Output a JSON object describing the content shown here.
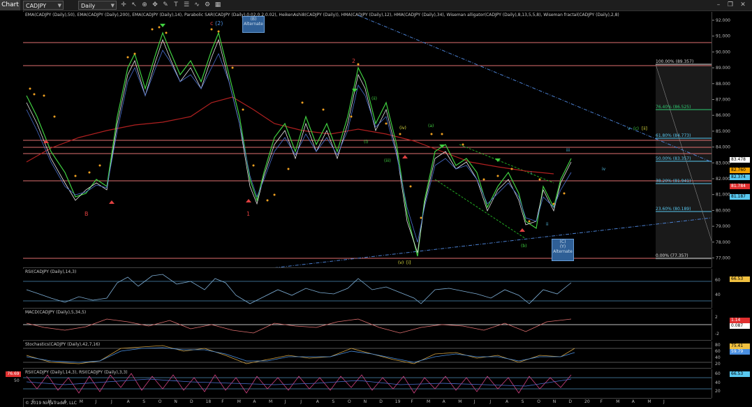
{
  "toolbar": {
    "chart_tab": "Chart",
    "instrument": "CADJPY",
    "period": "Daily",
    "icons": [
      "crosshair-icon",
      "pointer-icon",
      "zoom-icon",
      "pan-icon",
      "draw-icon",
      "text-icon",
      "properties-icon",
      "indicators-icon",
      "strategies-icon",
      "windows-icon",
      "minimize-icon",
      "restore-icon",
      "close-icon"
    ]
  },
  "price_panel": {
    "indicator_label": "EMA(CADJPY (Daily),50), EMA(CADJPY (Daily),200), EMA(CADJPY (Daily),14), Parabolic SAR(CADJPY (Daily),0.02,0.2,0.02), HeikenAshi8(CADJPY (Daily)), HMA(CADJPY (Daily),12), HMA(CADJPY (Daily),34), Wiseman alligator(CADJPY (Daily),8,13,5,5,8), Wiseman fractal(CADJPY (Daily),2,8)",
    "price_ticks": [
      "92.000",
      "91.000",
      "90.000",
      "89.000",
      "88.000",
      "87.000",
      "86.000",
      "85.000",
      "84.000",
      "83.000",
      "82.000",
      "81.000",
      "80.000",
      "79.000",
      "78.000",
      "77.000"
    ],
    "badges": [
      {
        "text": "83.478",
        "bg": "#ffffff"
      },
      {
        "text": "82.760",
        "bg": "#f0a000"
      },
      {
        "text": "82.374",
        "bg": "#58c8f0"
      },
      {
        "text": "81.784",
        "bg": "#e03030"
      },
      {
        "text": "81.187",
        "bg": "#58c8f0"
      }
    ],
    "fib_levels": [
      {
        "label": "100.00% (89.357)",
        "color": "#dddddd"
      },
      {
        "label": "76.40% (86.525)",
        "color": "#2ecc71"
      },
      {
        "label": "61.80% (84.773)",
        "color": "#58c8f0"
      },
      {
        "label": "50.00% (83.357)",
        "color": "#58c8f0"
      },
      {
        "label": "38.20% (81.941)",
        "color": "#58c8f0"
      },
      {
        "label": "23.60% (80.189)",
        "color": "#58c8f0"
      },
      {
        "label": "0.00% (77.357)",
        "color": "#dddddd"
      }
    ],
    "wave_labels": {
      "c2": "c",
      "two_paren": "(2)",
      "b_alt": "(B)",
      "alternate1": "Alternate",
      "two_red": "2",
      "B": "B",
      "one_red": "1",
      "ii_g": "(ii)",
      "i_g": "(i)",
      "iii_g": "(iii)",
      "iv_g": "(iv)",
      "a_g": "(a)",
      "v_g": "(v)",
      "i_bracket": "[i]",
      "b_g": "(b)",
      "c_alt": "(C)",
      "y_alt": "(Y)",
      "alternate2": "Alternate",
      "i_small": "i",
      "ii_small": "ii",
      "iii_small": "iii",
      "iv_small": "iv",
      "v_small": "v",
      "c_paren": "(c)",
      "ii_bracket": "[ii]"
    }
  },
  "rsi_panel": {
    "label": "RSI(CADJPY (Daily),14,3)",
    "ticks": [
      "60",
      "40"
    ],
    "badge": "66.53"
  },
  "macd_panel": {
    "label": "MACD(CADJPY (Daily),5,34,5)",
    "ticks": [
      "2",
      "-2"
    ],
    "badge1": "1.14",
    "badge2": "0.087"
  },
  "stoch_panel": {
    "label": "Stochastics(CADJPY (Daily),42,7,16)",
    "ticks": [
      "80",
      "60",
      "40",
      "20"
    ],
    "badge1": "75.41",
    "badge2": "59.79"
  },
  "rsi2_panel": {
    "label": "RSI(CADJPY (Daily),14,3), RSI(CADJPY (Daily),3,3)",
    "ticks": [
      "60",
      "40",
      "20"
    ],
    "badge": "66.53",
    "left_badge": "76.69",
    "left_tick": "50"
  },
  "x_axis": [
    "F",
    "M",
    "A",
    "M",
    "J",
    "J",
    "A",
    "S",
    "O",
    "N",
    "D",
    "18",
    "F",
    "M",
    "A",
    "M",
    "J",
    "J",
    "A",
    "S",
    "O",
    "N",
    "D",
    "19",
    "F",
    "M",
    "A",
    "M",
    "J",
    "J",
    "A",
    "S",
    "O",
    "N",
    "D",
    "20",
    "F",
    "M",
    "A",
    "M",
    "J"
  ],
  "copyright": "© 2019 NinjaTrader, LLC"
}
